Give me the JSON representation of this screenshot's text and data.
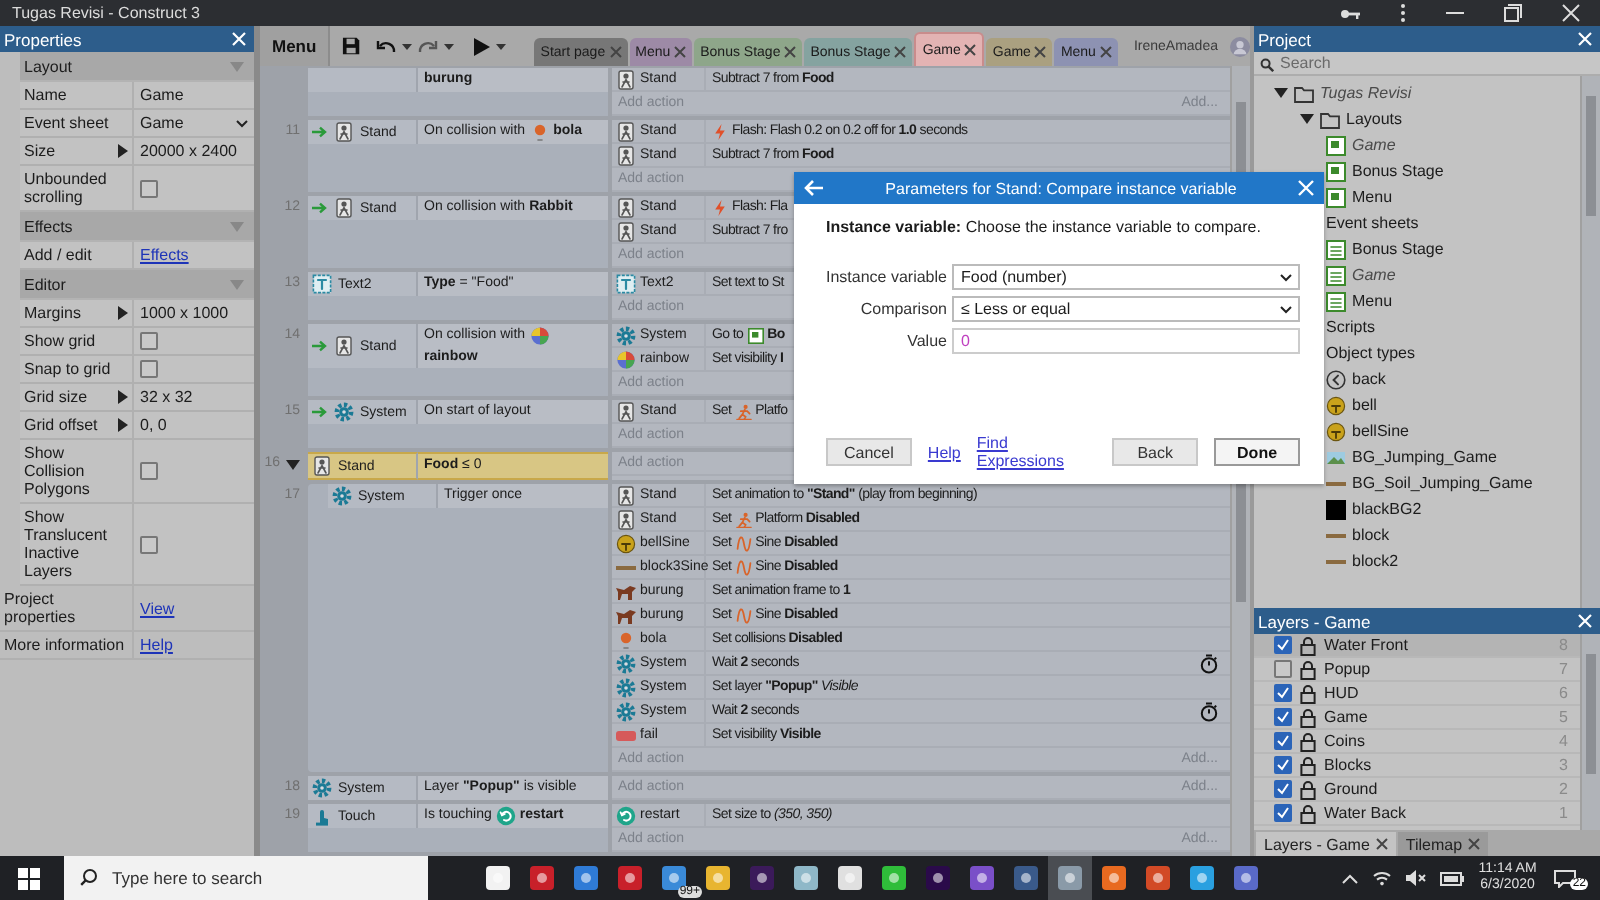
{
  "window": {
    "title": "Tugas Revisi - Construct 3"
  },
  "properties": {
    "title": "Properties",
    "sections": [
      {
        "title": "Layout",
        "rows": [
          {
            "kind": "text",
            "label": "Name",
            "value": "Game"
          },
          {
            "kind": "select",
            "label": "Event sheet",
            "value": "Game"
          },
          {
            "kind": "expand",
            "label": "Size",
            "value": "20000 x 2400"
          },
          {
            "kind": "check",
            "label": "Unbounded scrolling",
            "checked": false
          }
        ]
      },
      {
        "title": "Effects",
        "rows": [
          {
            "kind": "link",
            "label": "Add / edit",
            "value": "Effects"
          }
        ]
      },
      {
        "title": "Editor",
        "rows": [
          {
            "kind": "expand",
            "label": "Margins",
            "value": "1000 x 1000"
          },
          {
            "kind": "check",
            "label": "Show grid",
            "checked": false
          },
          {
            "kind": "check",
            "label": "Snap to grid",
            "checked": false
          },
          {
            "kind": "expand",
            "label": "Grid size",
            "value": "32 x 32"
          },
          {
            "kind": "expand",
            "label": "Grid offset",
            "value": "0, 0"
          },
          {
            "kind": "check",
            "label": "Show Collision Polygons",
            "checked": false
          },
          {
            "kind": "check",
            "label": "Show Translucent Inactive Layers",
            "checked": false
          }
        ]
      }
    ],
    "footer": [
      {
        "label": "Project properties",
        "link": "View"
      },
      {
        "label": "More information",
        "link": "Help"
      }
    ]
  },
  "toolbar": {
    "menu": "Menu"
  },
  "tabs": [
    {
      "label": "Start page",
      "color": "#777777",
      "selected": false
    },
    {
      "label": "Menu",
      "color": "#9d8aa6",
      "selected": false
    },
    {
      "label": "Bonus Stage",
      "color": "#8ea68a",
      "selected": false
    },
    {
      "label": "Bonus Stage",
      "color": "#85a3a0",
      "selected": false
    },
    {
      "label": "Game",
      "color": "#e3b3b3",
      "selected": true
    },
    {
      "label": "Game",
      "color": "#aaa080",
      "selected": false
    },
    {
      "label": "Menu",
      "color": "#8d92b2",
      "selected": false
    }
  ],
  "user": "IreneAmadea",
  "events": [
    {
      "trigger": false,
      "conditions": [
        {
          "parts": [
            {
              "kind": "text",
              "text": "**burung**"
            }
          ]
        }
      ],
      "actions": [
        {
          "object": {
            "kind": "figure",
            "name": "Stand"
          },
          "parts": [
            {
              "kind": "text",
              "text": "Subtract 7 from **Food**"
            }
          ]
        }
      ],
      "add_action": "Add action",
      "add_link": "Add..."
    },
    {
      "number": "11",
      "trigger": true,
      "conditions": [
        {
          "object": {
            "kind": "figure",
            "name": "Stand"
          },
          "parts": [
            {
              "kind": "text",
              "text": "On collision with"
            },
            {
              "kind": "ball"
            },
            {
              "kind": "text",
              "text": "**bola**"
            }
          ]
        }
      ],
      "actions": [
        {
          "object": {
            "kind": "figure",
            "name": "Stand"
          },
          "parts": [
            {
              "kind": "flash"
            },
            {
              "kind": "text",
              "text": "Flash: Flash 0.2 on 0.2 off for **1.0** seconds"
            }
          ]
        },
        {
          "object": {
            "kind": "figure",
            "name": "Stand"
          },
          "parts": [
            {
              "kind": "text",
              "text": "Subtract 7 from **Food**"
            }
          ]
        }
      ],
      "add_action": "Add action"
    },
    {
      "number": "12",
      "trigger": true,
      "conditions": [
        {
          "object": {
            "kind": "figure",
            "name": "Stand"
          },
          "parts": [
            {
              "kind": "text",
              "text": "On collision with"
            },
            {
              "kind": "text",
              "text": "**Rabbit**"
            }
          ]
        }
      ],
      "actions": [
        {
          "object": {
            "kind": "figure",
            "name": "Stand"
          },
          "parts": [
            {
              "kind": "flash"
            },
            {
              "kind": "text",
              "text": "Flash: Fla"
            }
          ]
        },
        {
          "object": {
            "kind": "figure",
            "name": "Stand"
          },
          "parts": [
            {
              "kind": "text",
              "text": "Subtract 7 fro"
            }
          ]
        }
      ],
      "add_action": "Add action"
    },
    {
      "number": "13",
      "trigger": false,
      "conditions": [
        {
          "object": {
            "kind": "text-object",
            "name": "Text2"
          },
          "parts": [
            {
              "kind": "text",
              "text": "**Type** = \"Food\""
            }
          ]
        }
      ],
      "actions": [
        {
          "object": {
            "kind": "text-object",
            "name": "Text2"
          },
          "parts": [
            {
              "kind": "text",
              "text": "Set text to St"
            }
          ]
        }
      ],
      "add_action": "Add action"
    },
    {
      "number": "14",
      "trigger": true,
      "conditions": [
        {
          "object": {
            "kind": "figure",
            "name": "Stand"
          },
          "parts": [
            {
              "kind": "text",
              "text": "On collision with"
            },
            {
              "kind": "rainbow"
            },
            {
              "kind": "text",
              "text": "**rainbow**"
            }
          ]
        }
      ],
      "actions": [
        {
          "object": {
            "kind": "gear",
            "name": "System"
          },
          "parts": [
            {
              "kind": "text",
              "text": "Go to"
            },
            {
              "kind": "layout"
            },
            {
              "kind": "text",
              "text": "**Bo**"
            }
          ]
        },
        {
          "object": {
            "kind": "rainbow",
            "name": "rainbow"
          },
          "parts": [
            {
              "kind": "text",
              "text": "Set visibility **I**"
            }
          ]
        }
      ],
      "add_action": "Add action"
    },
    {
      "number": "15",
      "trigger": true,
      "conditions": [
        {
          "object": {
            "kind": "gear",
            "name": "System"
          },
          "parts": [
            {
              "kind": "text",
              "text": "On start of layout"
            }
          ]
        }
      ],
      "actions": [
        {
          "object": {
            "kind": "figure",
            "name": "Stand"
          },
          "parts": [
            {
              "kind": "text",
              "text": "Set"
            },
            {
              "kind": "runner"
            },
            {
              "kind": "text",
              "text": "Platfo"
            }
          ]
        }
      ],
      "add_action": "Add action"
    },
    {
      "number": "16",
      "trigger": false,
      "selected": true,
      "expanded": true,
      "conditions": [
        {
          "object": {
            "kind": "figure",
            "name": "Stand"
          },
          "parts": [
            {
              "kind": "text",
              "text": "**Food** ≤ 0"
            }
          ]
        }
      ],
      "add_action": "Add action",
      "children": [
        {
          "number": "17",
          "trigger": false,
          "conditions": [
            {
              "object": {
                "kind": "gear",
                "name": "System"
              },
              "parts": [
                {
                  "kind": "text",
                  "text": "Trigger once"
                }
              ]
            }
          ],
          "actions": [
            {
              "object": {
                "kind": "figure",
                "name": "Stand"
              },
              "parts": [
                {
                  "kind": "text",
                  "text": "Set animation to **\"Stand\"** (play from beginning)"
                }
              ]
            },
            {
              "object": {
                "kind": "figure",
                "name": "Stand"
              },
              "parts": [
                {
                  "kind": "text",
                  "text": "Set"
                },
                {
                  "kind": "runner"
                },
                {
                  "kind": "text",
                  "text": "Platform **Disabled**"
                }
              ]
            },
            {
              "object": {
                "kind": "bell",
                "name": "bellSine"
              },
              "parts": [
                {
                  "kind": "text",
                  "text": "Set"
                },
                {
                  "kind": "sine"
                },
                {
                  "kind": "text",
                  "text": "Sine **Disabled**"
                }
              ]
            },
            {
              "object": {
                "kind": "plank",
                "name": "block3Sine"
              },
              "parts": [
                {
                  "kind": "text",
                  "text": "Set"
                },
                {
                  "kind": "sine"
                },
                {
                  "kind": "text",
                  "text": "Sine **Disabled**"
                }
              ]
            },
            {
              "object": {
                "kind": "bird",
                "name": "burung"
              },
              "parts": [
                {
                  "kind": "text",
                  "text": "Set animation frame to **1**"
                }
              ]
            },
            {
              "object": {
                "kind": "bird",
                "name": "burung"
              },
              "parts": [
                {
                  "kind": "text",
                  "text": "Set"
                },
                {
                  "kind": "sine"
                },
                {
                  "kind": "text",
                  "text": "Sine **Disabled**"
                }
              ]
            },
            {
              "object": {
                "kind": "ball",
                "name": "bola"
              },
              "parts": [
                {
                  "kind": "text",
                  "text": "Set collisions **Disabled**"
                }
              ]
            },
            {
              "object": {
                "kind": "gear",
                "name": "System"
              },
              "parts": [
                {
                  "kind": "text",
                  "text": "Wait **2** seconds"
                }
              ],
              "timer": true
            },
            {
              "object": {
                "kind": "gear",
                "name": "System"
              },
              "parts": [
                {
                  "kind": "text",
                  "text": "Set layer **\"Popup\"** *Visible*"
                }
              ]
            },
            {
              "object": {
                "kind": "gear",
                "name": "System"
              },
              "parts": [
                {
                  "kind": "text",
                  "text": "Wait **2** seconds"
                }
              ],
              "timer": true
            },
            {
              "object": {
                "kind": "sign",
                "name": "fail"
              },
              "parts": [
                {
                  "kind": "text",
                  "text": "Set visibility **Visible**"
                }
              ]
            }
          ],
          "add_action": "Add action",
          "add_link": "Add..."
        }
      ]
    },
    {
      "number": "18",
      "trigger": false,
      "conditions": [
        {
          "object": {
            "kind": "gear",
            "name": "System"
          },
          "parts": [
            {
              "kind": "text",
              "text": "Layer **\"Popup\"** is visible"
            }
          ]
        }
      ],
      "add_action": "Add action",
      "add_link": "Add..."
    },
    {
      "number": "19",
      "trigger": false,
      "conditions": [
        {
          "object": {
            "kind": "hand",
            "name": "Touch"
          },
          "parts": [
            {
              "kind": "text",
              "text": "Is touching"
            },
            {
              "kind": "restart"
            },
            {
              "kind": "text",
              "text": "**restart**"
            }
          ]
        }
      ],
      "actions": [
        {
          "object": {
            "kind": "restart",
            "name": "restart"
          },
          "parts": [
            {
              "kind": "text",
              "text": "Set size to *(350, 350)*"
            }
          ]
        }
      ],
      "add_action": "Add action",
      "add_link": "Add..."
    }
  ],
  "dialog": {
    "title": "Parameters for Stand: Compare instance variable",
    "description": "**Instance variable:** Choose the instance variable to compare.",
    "fields": [
      {
        "kind": "select",
        "label": "Instance variable",
        "value": "Food (number)"
      },
      {
        "kind": "select",
        "label": "Comparison",
        "value": "≤ Less or equal"
      },
      {
        "kind": "input",
        "label": "Value",
        "value": "0"
      }
    ],
    "buttons": [
      {
        "kind": "button",
        "label": "Cancel"
      },
      {
        "kind": "link",
        "label": "Help"
      },
      {
        "kind": "link",
        "label": "Find Expressions"
      },
      {
        "kind": "button",
        "label": "Back"
      },
      {
        "kind": "primary",
        "label": "Done"
      }
    ]
  },
  "project": {
    "title": "Project",
    "search_placeholder": "Search",
    "tree": [
      {
        "label": "Tugas Revisi",
        "kind": "folder",
        "italic": true,
        "expanded": true,
        "children": [
          {
            "label": "Layouts",
            "kind": "folder",
            "italic": false,
            "expanded": true,
            "children": [
              {
                "label": "Game",
                "kind": "layout",
                "italic": true
              },
              {
                "label": "Bonus Stage",
                "kind": "layout",
                "italic": false
              },
              {
                "label": "Menu",
                "kind": "layout",
                "italic": false
              }
            ]
          },
          {
            "label": "Event sheets",
            "kind": "section",
            "italic": false,
            "children": [
              {
                "label": "Bonus Stage",
                "kind": "sheet",
                "italic": false
              },
              {
                "label": "Game",
                "kind": "sheet",
                "italic": true
              },
              {
                "label": "Menu",
                "kind": "sheet",
                "italic": false
              }
            ]
          },
          {
            "label": "Scripts",
            "kind": "section",
            "italic": false
          },
          {
            "label": "Object types",
            "kind": "section",
            "italic": false,
            "children": [
              {
                "label": "back",
                "kind": "back",
                "italic": false
              },
              {
                "label": "bell",
                "kind": "bell",
                "italic": false
              },
              {
                "label": "bellSine",
                "kind": "bell",
                "italic": false
              },
              {
                "label": "BG_Jumping_Game",
                "kind": "image",
                "italic": false
              },
              {
                "label": "BG_Soil_Jumping_Game",
                "kind": "plank",
                "italic": false
              },
              {
                "label": "blackBG2",
                "kind": "square",
                "italic": false
              },
              {
                "label": "block",
                "kind": "plank",
                "italic": false
              },
              {
                "label": "block2",
                "kind": "plank",
                "italic": false
              }
            ]
          }
        ]
      }
    ]
  },
  "layers": {
    "title": "Layers - Game",
    "items": [
      {
        "name": "Water Front",
        "number": "8",
        "visible": true
      },
      {
        "name": "Popup",
        "number": "7",
        "visible": false
      },
      {
        "name": "HUD",
        "number": "6",
        "visible": true
      },
      {
        "name": "Game",
        "number": "5",
        "visible": true
      },
      {
        "name": "Coins",
        "number": "4",
        "visible": true
      },
      {
        "name": "Blocks",
        "number": "3",
        "visible": true
      },
      {
        "name": "Ground",
        "number": "2",
        "visible": true
      },
      {
        "name": "Water Back",
        "number": "1",
        "visible": true
      }
    ]
  },
  "bottom_tabs": [
    {
      "label": "Layers - Game",
      "selected": true
    },
    {
      "label": "Tilemap",
      "selected": false
    }
  ],
  "taskbar": {
    "search_placeholder": "Type here to search",
    "badge": "99+",
    "time": "11:14 AM",
    "date": "6/3/2020",
    "notifications": "22"
  }
}
